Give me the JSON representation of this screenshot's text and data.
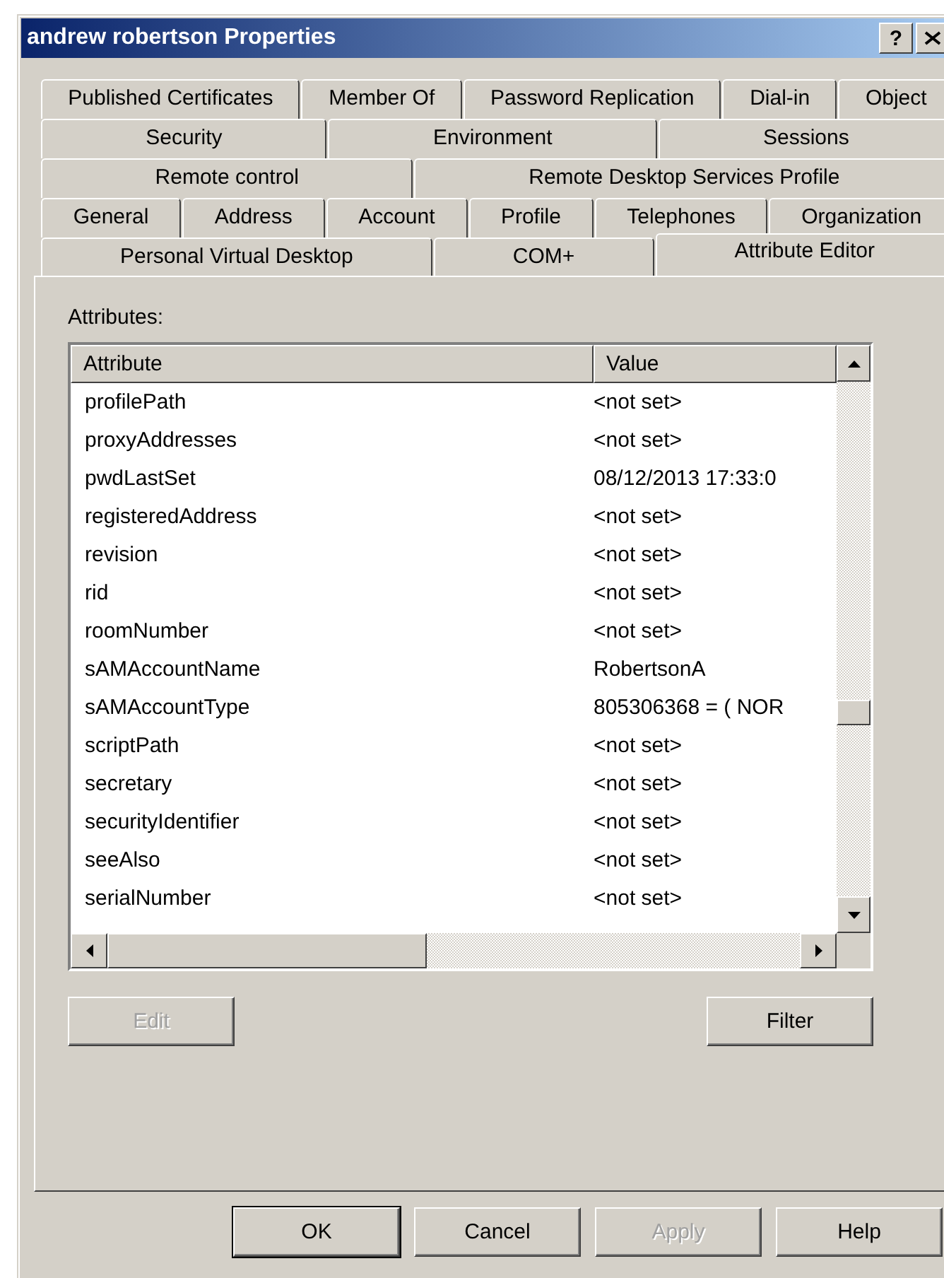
{
  "window": {
    "title": "andrew robertson Properties",
    "help_button": "?"
  },
  "tab_rows": [
    [
      {
        "label": "Published Certificates",
        "selected": false
      },
      {
        "label": "Member Of",
        "selected": false
      },
      {
        "label": "Password Replication",
        "selected": false
      },
      {
        "label": "Dial-in",
        "selected": false
      },
      {
        "label": "Object",
        "selected": false
      }
    ],
    [
      {
        "label": "Security",
        "selected": false
      },
      {
        "label": "Environment",
        "selected": false
      },
      {
        "label": "Sessions",
        "selected": false
      }
    ],
    [
      {
        "label": "Remote control",
        "selected": false
      },
      {
        "label": "Remote Desktop Services Profile",
        "selected": false
      }
    ],
    [
      {
        "label": "General",
        "selected": false
      },
      {
        "label": "Address",
        "selected": false
      },
      {
        "label": "Account",
        "selected": false
      },
      {
        "label": "Profile",
        "selected": false
      },
      {
        "label": "Telephones",
        "selected": false
      },
      {
        "label": "Organization",
        "selected": false
      }
    ],
    [
      {
        "label": "Personal Virtual Desktop",
        "selected": false
      },
      {
        "label": "COM+",
        "selected": false
      },
      {
        "label": "Attribute Editor",
        "selected": true
      }
    ]
  ],
  "attributes": {
    "label": "Attributes:",
    "columns": [
      "Attribute",
      "Value"
    ],
    "rows": [
      {
        "attribute": "profilePath",
        "value": "<not set>"
      },
      {
        "attribute": "proxyAddresses",
        "value": "<not set>"
      },
      {
        "attribute": "pwdLastSet",
        "value": "08/12/2013 17:33:0"
      },
      {
        "attribute": "registeredAddress",
        "value": "<not set>"
      },
      {
        "attribute": "revision",
        "value": "<not set>"
      },
      {
        "attribute": "rid",
        "value": "<not set>"
      },
      {
        "attribute": "roomNumber",
        "value": "<not set>"
      },
      {
        "attribute": "sAMAccountName",
        "value": "RobertsonA"
      },
      {
        "attribute": "sAMAccountType",
        "value": "805306368 = ( NOR"
      },
      {
        "attribute": "scriptPath",
        "value": "<not set>"
      },
      {
        "attribute": "secretary",
        "value": "<not set>"
      },
      {
        "attribute": "securityIdentifier",
        "value": "<not set>"
      },
      {
        "attribute": "seeAlso",
        "value": "<not set>"
      },
      {
        "attribute": "serialNumber",
        "value": "<not set>"
      }
    ]
  },
  "list_buttons": [
    {
      "label": "Edit",
      "disabled": true
    },
    {
      "label": "Filter",
      "disabled": false
    }
  ],
  "dialog_buttons": [
    {
      "label": "OK",
      "disabled": false,
      "default": true
    },
    {
      "label": "Cancel",
      "disabled": false,
      "default": false
    },
    {
      "label": "Apply",
      "disabled": true,
      "default": false
    },
    {
      "label": "Help",
      "disabled": false,
      "default": false
    }
  ]
}
